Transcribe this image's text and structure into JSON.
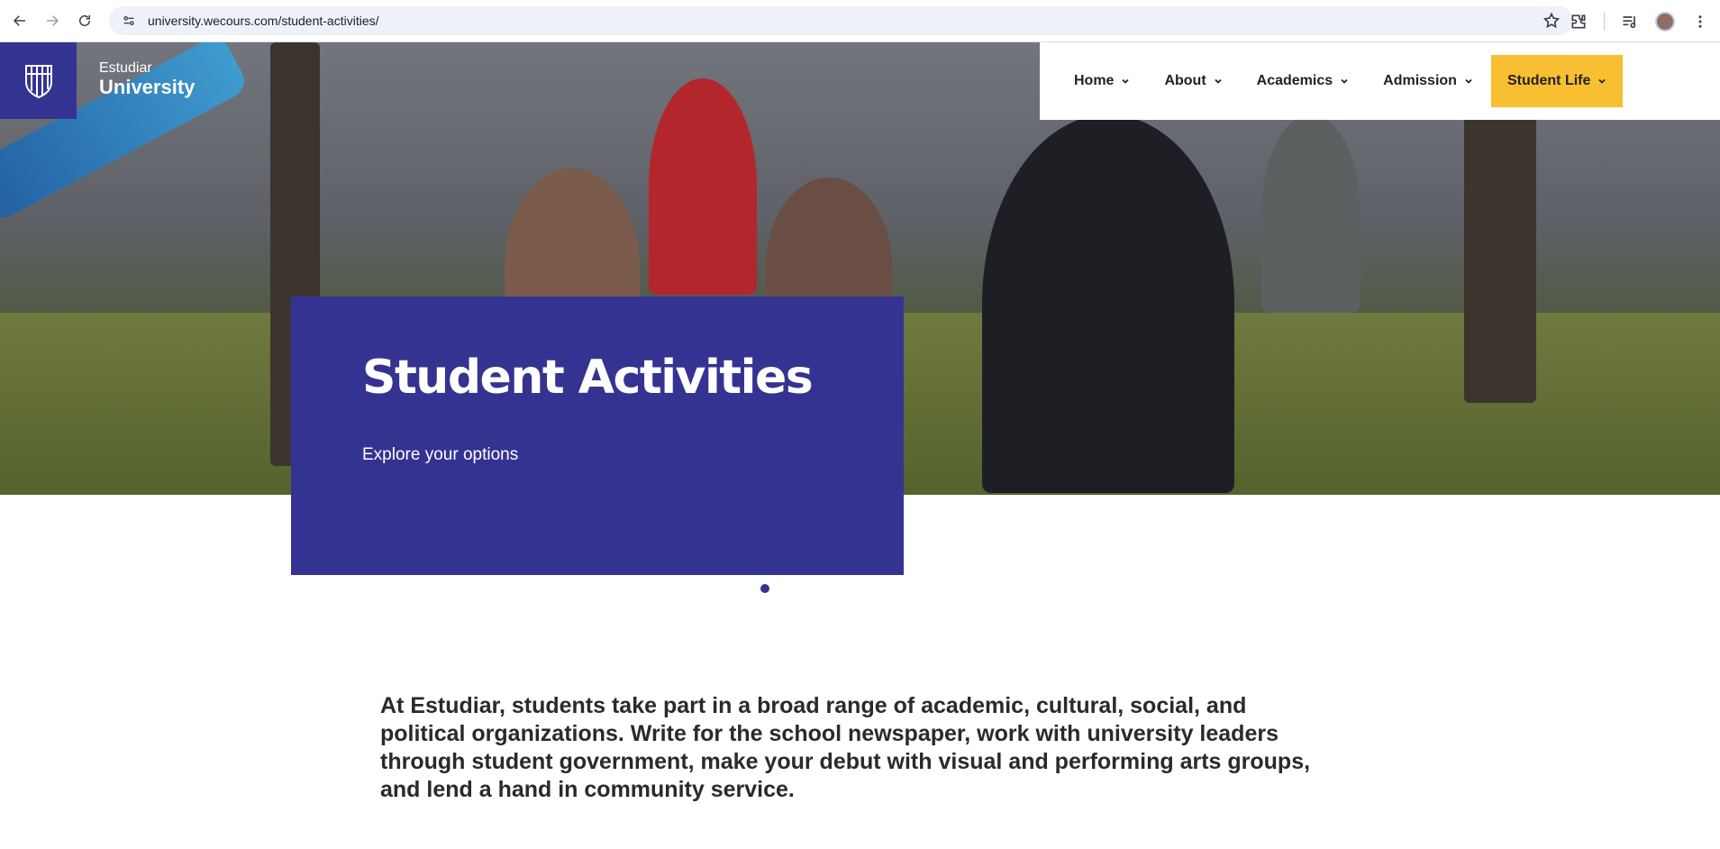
{
  "browser": {
    "url": "university.wecours.com/student-activities/",
    "icons": [
      "back-icon",
      "forward-icon",
      "reload-icon",
      "site-info-icon",
      "bookmark-star-icon",
      "extensions-icon",
      "media-control-icon",
      "profile-avatar",
      "menu-icon"
    ]
  },
  "site": {
    "logo_small": "Estudiar",
    "logo_big": "University"
  },
  "nav": {
    "items": [
      {
        "label": "Home"
      },
      {
        "label": "About"
      },
      {
        "label": "Academics"
      },
      {
        "label": "Admission"
      },
      {
        "label": "Student Life"
      }
    ],
    "active_color": "#f7bf31"
  },
  "hero": {
    "title": "Student Activities",
    "subtitle": "Explore your options",
    "card_color": "#353391"
  },
  "intro": {
    "text": "At Estudiar, students take part in a broad range of academic, cultural, social, and political organizations. Write for the school newspaper, work with university leaders through student government, make your debut with visual and performing arts groups, and lend a hand in community service."
  }
}
